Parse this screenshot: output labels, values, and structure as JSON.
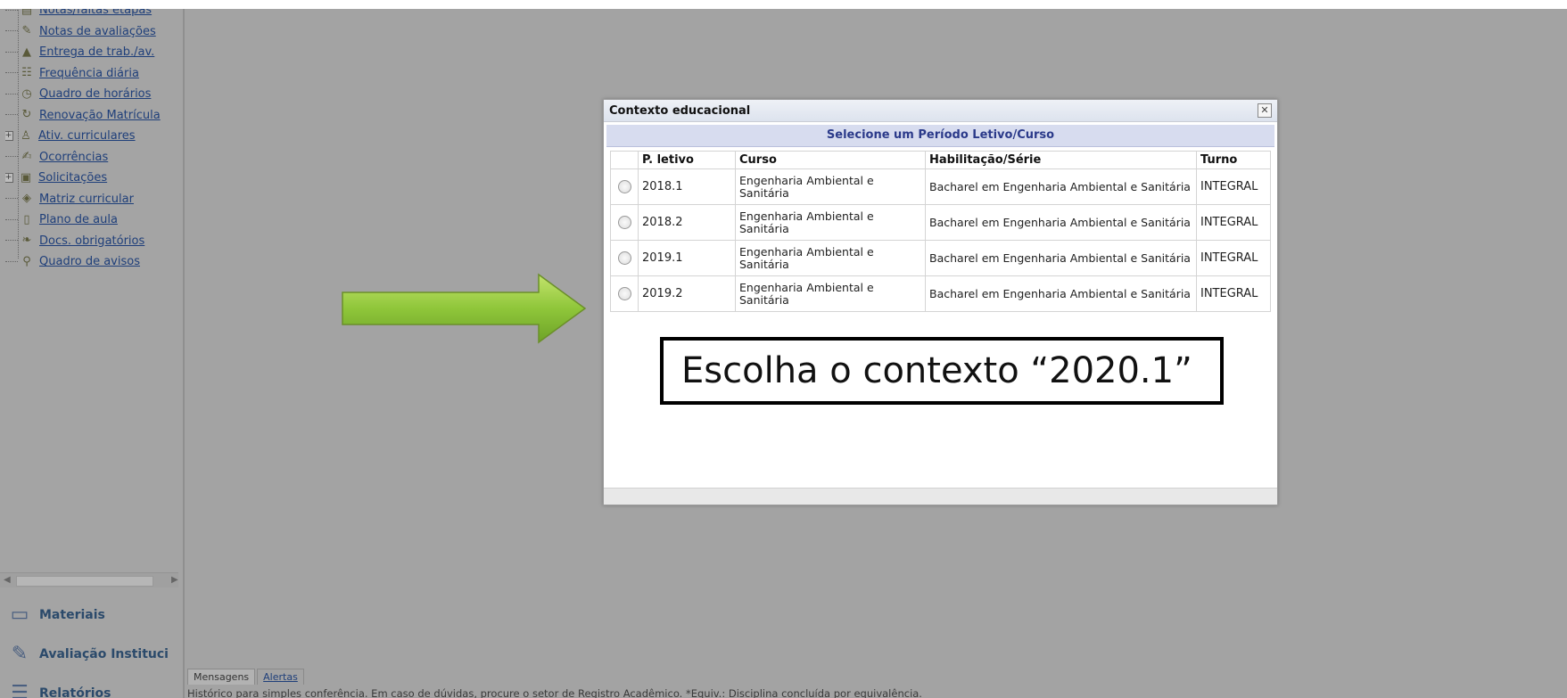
{
  "sidebar": {
    "items": [
      {
        "label": "Notas/faltas etapas",
        "icon": "notes-icon",
        "expander": ""
      },
      {
        "label": "Notas de avaliações",
        "icon": "pen-icon",
        "expander": ""
      },
      {
        "label": "Entrega de trab./av.",
        "icon": "delivery-icon",
        "expander": ""
      },
      {
        "label": "Frequência diária",
        "icon": "attendance-icon",
        "expander": ""
      },
      {
        "label": "Quadro de horários",
        "icon": "clock-icon",
        "expander": ""
      },
      {
        "label": "Renovação Matrícula",
        "icon": "renewal-icon",
        "expander": ""
      },
      {
        "label": "Ativ. curriculares",
        "icon": "activity-icon",
        "expander": "+"
      },
      {
        "label": "Ocorrências",
        "icon": "occurrence-icon",
        "expander": ""
      },
      {
        "label": "Solicitações",
        "icon": "request-icon",
        "expander": "+"
      },
      {
        "label": "Matriz curricular",
        "icon": "matrix-icon",
        "expander": ""
      },
      {
        "label": "Plano de aula",
        "icon": "lesson-plan-icon",
        "expander": ""
      },
      {
        "label": "Docs. obrigatórios",
        "icon": "documents-icon",
        "expander": ""
      },
      {
        "label": "Quadro de avisos",
        "icon": "notice-board-icon",
        "expander": ""
      }
    ],
    "panels": {
      "materiais": "Materiais",
      "avaliacao": "Avaliação Instituci",
      "relatorios": "Relatórios"
    }
  },
  "bottom": {
    "tab_mensagens": "Mensagens",
    "tab_alertas": "Alertas",
    "footnote": "Histórico para simples conferência. Em caso de dúvidas, procure o setor de Registro Acadêmico. *Equiv.: Disciplina concluída por equivalência."
  },
  "modal": {
    "title": "Contexto educacional",
    "close_label": "✕",
    "subheader": "Selecione um Período Letivo/Curso",
    "columns": [
      "P. letivo",
      "Curso",
      "Habilitação/Série",
      "Turno"
    ],
    "rows": [
      {
        "periodo": "2018.1",
        "curso": "Engenharia Ambiental e Sanitária",
        "habilitacao": "Bacharel em Engenharia Ambiental e Sanitária",
        "turno": "INTEGRAL"
      },
      {
        "periodo": "2018.2",
        "curso": "Engenharia Ambiental e Sanitária",
        "habilitacao": "Bacharel em Engenharia Ambiental e Sanitária",
        "turno": "INTEGRAL"
      },
      {
        "periodo": "2019.1",
        "curso": "Engenharia Ambiental e Sanitária",
        "habilitacao": "Bacharel em Engenharia Ambiental e Sanitária",
        "turno": "INTEGRAL"
      },
      {
        "periodo": "2019.2",
        "curso": "Engenharia Ambiental e Sanitária",
        "habilitacao": "Bacharel em Engenharia Ambiental e Sanitária",
        "turno": "INTEGRAL"
      }
    ]
  },
  "annotation": {
    "text": "Escolha o contexto “2020.1”",
    "arrow_color": "#8fc63a"
  }
}
